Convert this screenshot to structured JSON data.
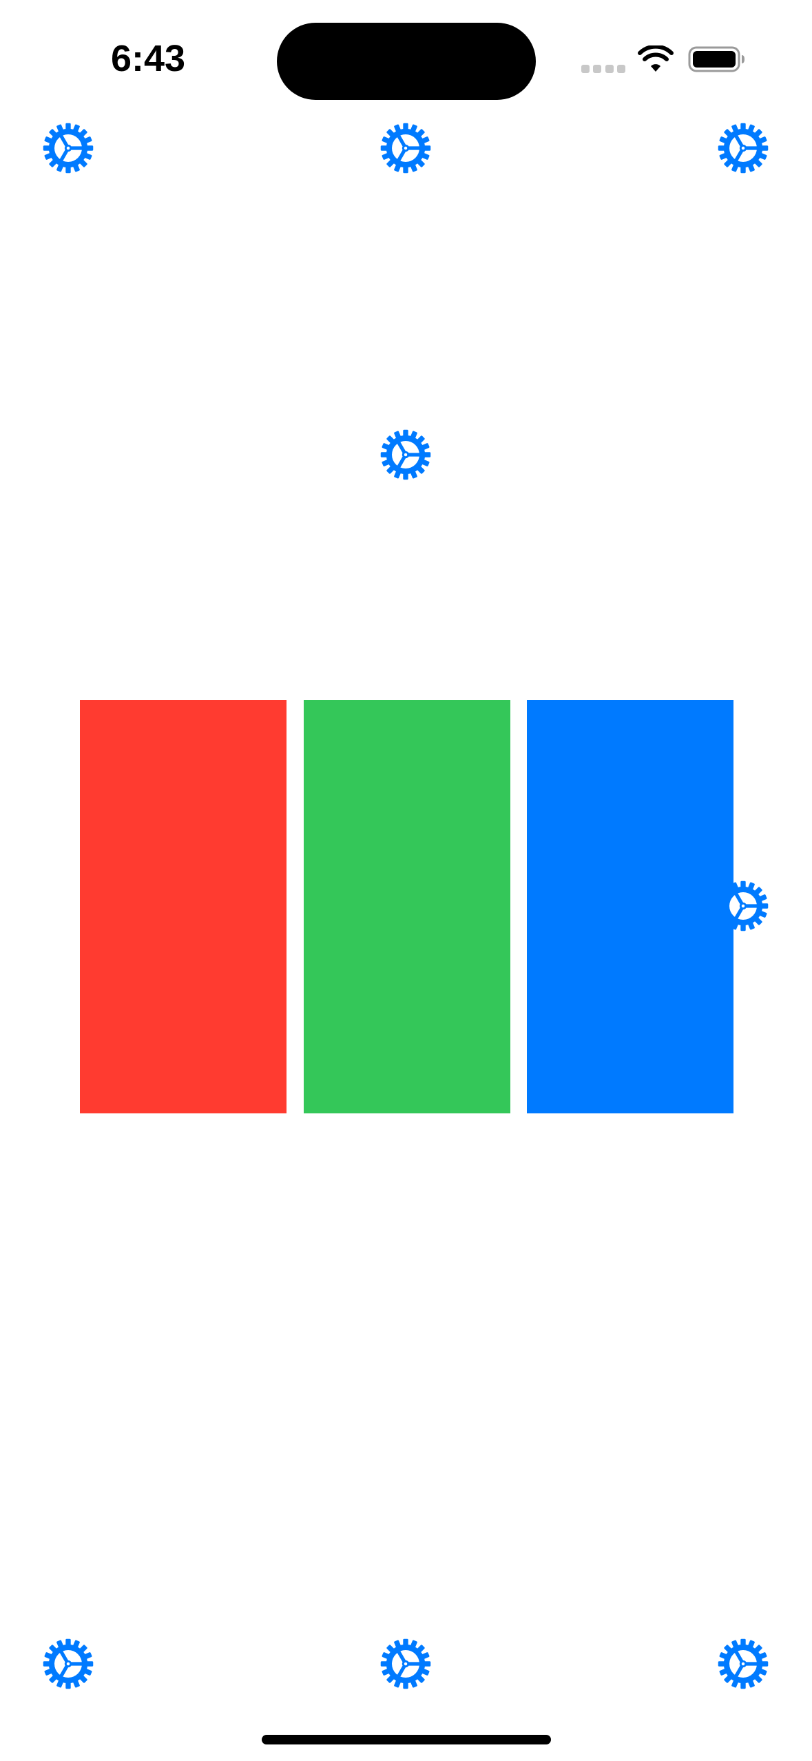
{
  "status_bar": {
    "time": "6:43",
    "signal_icon": "cellular-signal-icon",
    "wifi_icon": "wifi-icon",
    "battery_icon": "battery-icon"
  },
  "colors": {
    "accent": "#007AFF",
    "text": "#000000",
    "background": "#FFFFFF"
  },
  "gear_icons": {
    "icon": "gear-icon",
    "color": "#007AFF",
    "count": 8
  },
  "color_bars": [
    {
      "name": "red",
      "color": "#FF3B30"
    },
    {
      "name": "green",
      "color": "#34C759"
    },
    {
      "name": "blue",
      "color": "#007AFF"
    }
  ]
}
